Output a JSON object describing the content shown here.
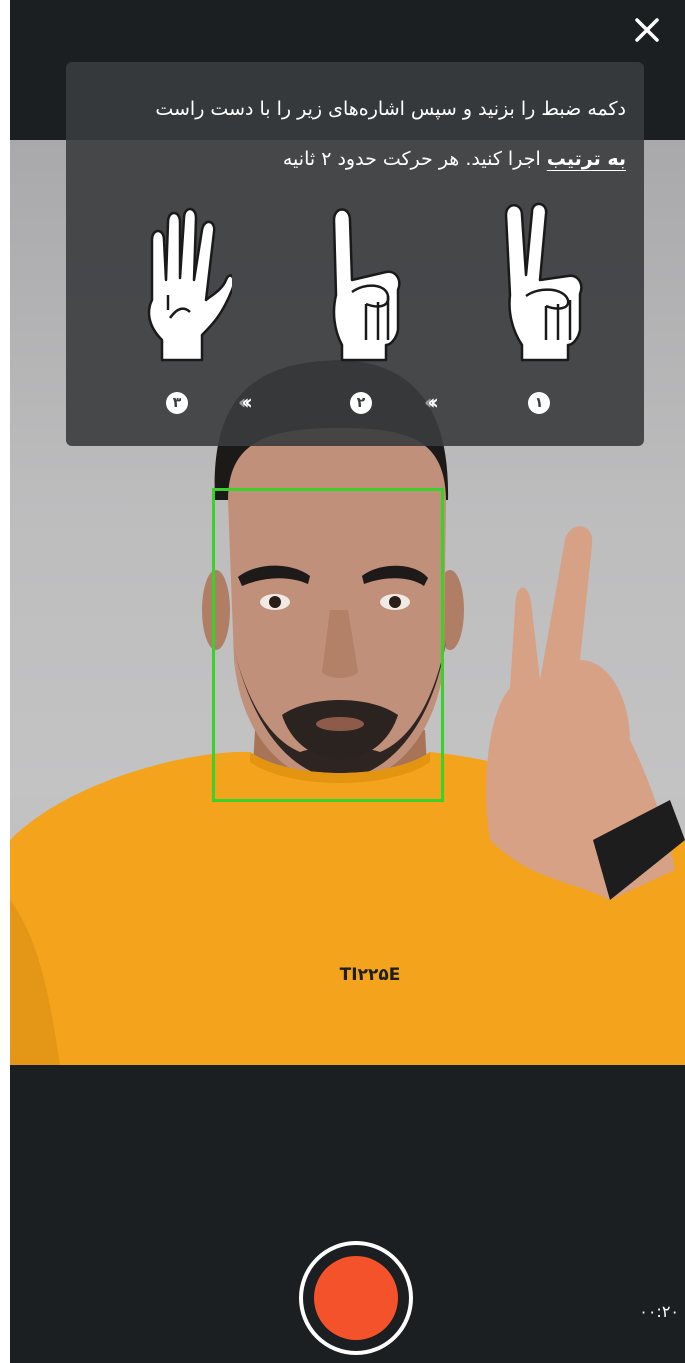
{
  "instructions": {
    "line1": "دکمه ضبط را بزنید و سپس اشاره‌های زیر را با دست راست",
    "line2_bold": "به ترتیب",
    "line2_rest": " اجرا کنید. هر حرکت حدود ۲ ثانیه"
  },
  "gestures": [
    {
      "step": "۱",
      "icon": "peace-sign-hand-icon"
    },
    {
      "step": "۲",
      "icon": "index-finger-hand-icon"
    },
    {
      "step": "۳",
      "icon": "open-palm-hand-icon"
    }
  ],
  "shirt_text": "TI۲۲۵E",
  "timer": "۰۰:۲۰",
  "colors": {
    "face_box": "#3bd12b",
    "record": "#f4522b",
    "background": "#1b1f22"
  }
}
